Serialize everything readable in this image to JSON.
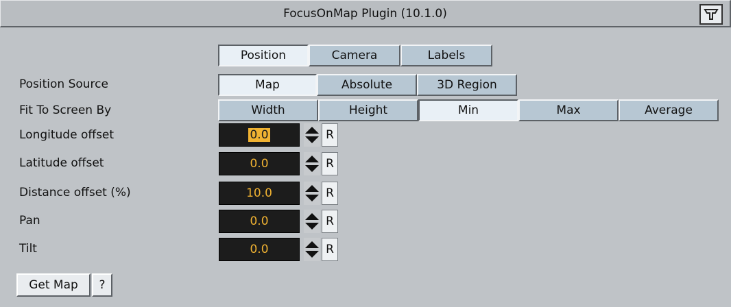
{
  "title": "FocusOnMap Plugin (10.1.0)",
  "tabs": [
    "Position",
    "Camera",
    "Labels"
  ],
  "position_source": {
    "label": "Position Source",
    "options": [
      "Map",
      "Absolute",
      "3D Region"
    ],
    "selected": "Map"
  },
  "fit_to_screen": {
    "label": "Fit To Screen By",
    "options": [
      "Width",
      "Height",
      "Min",
      "Max",
      "Average"
    ],
    "selected": "Min"
  },
  "fields": [
    {
      "label": "Longitude offset",
      "value": "0.0"
    },
    {
      "label": "Latitude offset",
      "value": "0.0"
    },
    {
      "label": "Distance offset (%)",
      "value": "10.0"
    },
    {
      "label": "Pan",
      "value": "0.0"
    },
    {
      "label": "Tilt",
      "value": "0.0"
    }
  ],
  "reset_label": "R",
  "get_map_label": "Get Map",
  "help_label": "?",
  "colors": {
    "accent": "#f0b232",
    "field_bg": "#1c1c1c",
    "panel_bg": "#bfc3c7"
  }
}
